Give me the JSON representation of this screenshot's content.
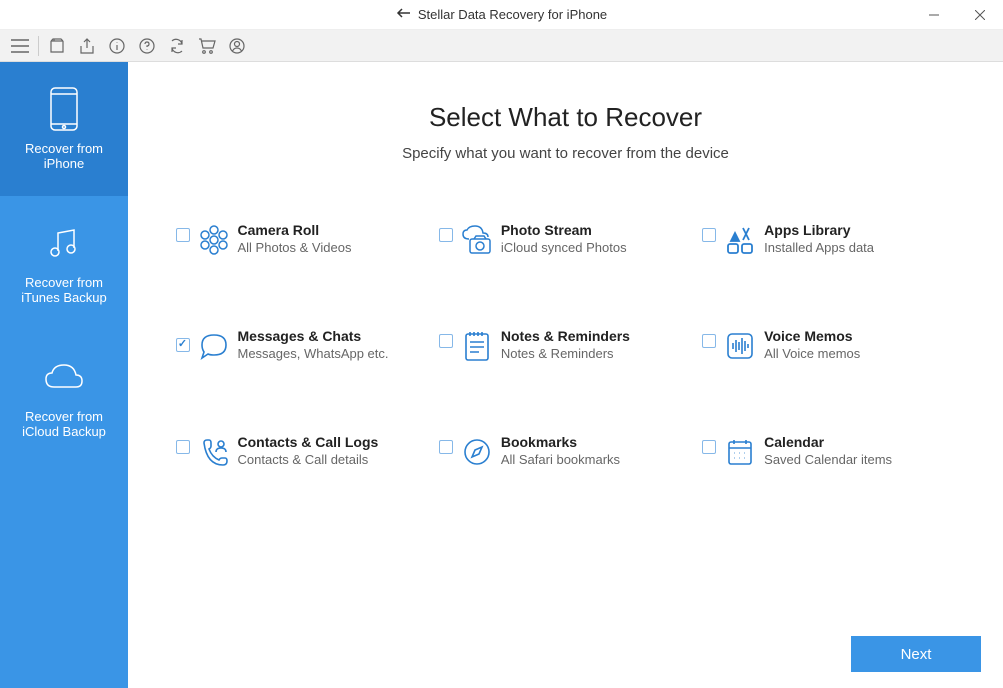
{
  "titlebar": {
    "title": "Stellar Data Recovery for iPhone"
  },
  "sidebar": {
    "items": [
      {
        "label": "Recover from iPhone"
      },
      {
        "label": "Recover from iTunes Backup"
      },
      {
        "label": "Recover from iCloud Backup"
      }
    ]
  },
  "main": {
    "title": "Select What to Recover",
    "subtitle": "Specify what you want to recover from the device"
  },
  "options": [
    {
      "title": "Camera Roll",
      "desc": "All Photos & Videos",
      "checked": false
    },
    {
      "title": "Photo Stream",
      "desc": "iCloud synced Photos",
      "checked": false
    },
    {
      "title": "Apps Library",
      "desc": "Installed Apps data",
      "checked": false
    },
    {
      "title": "Messages & Chats",
      "desc": "Messages, WhatsApp etc.",
      "checked": true
    },
    {
      "title": "Notes & Reminders",
      "desc": "Notes & Reminders",
      "checked": false
    },
    {
      "title": "Voice Memos",
      "desc": "All Voice memos",
      "checked": false
    },
    {
      "title": "Contacts & Call Logs",
      "desc": "Contacts & Call details",
      "checked": false
    },
    {
      "title": "Bookmarks",
      "desc": "All Safari bookmarks",
      "checked": false
    },
    {
      "title": "Calendar",
      "desc": "Saved Calendar items",
      "checked": false
    }
  ],
  "footer": {
    "next_label": "Next"
  }
}
